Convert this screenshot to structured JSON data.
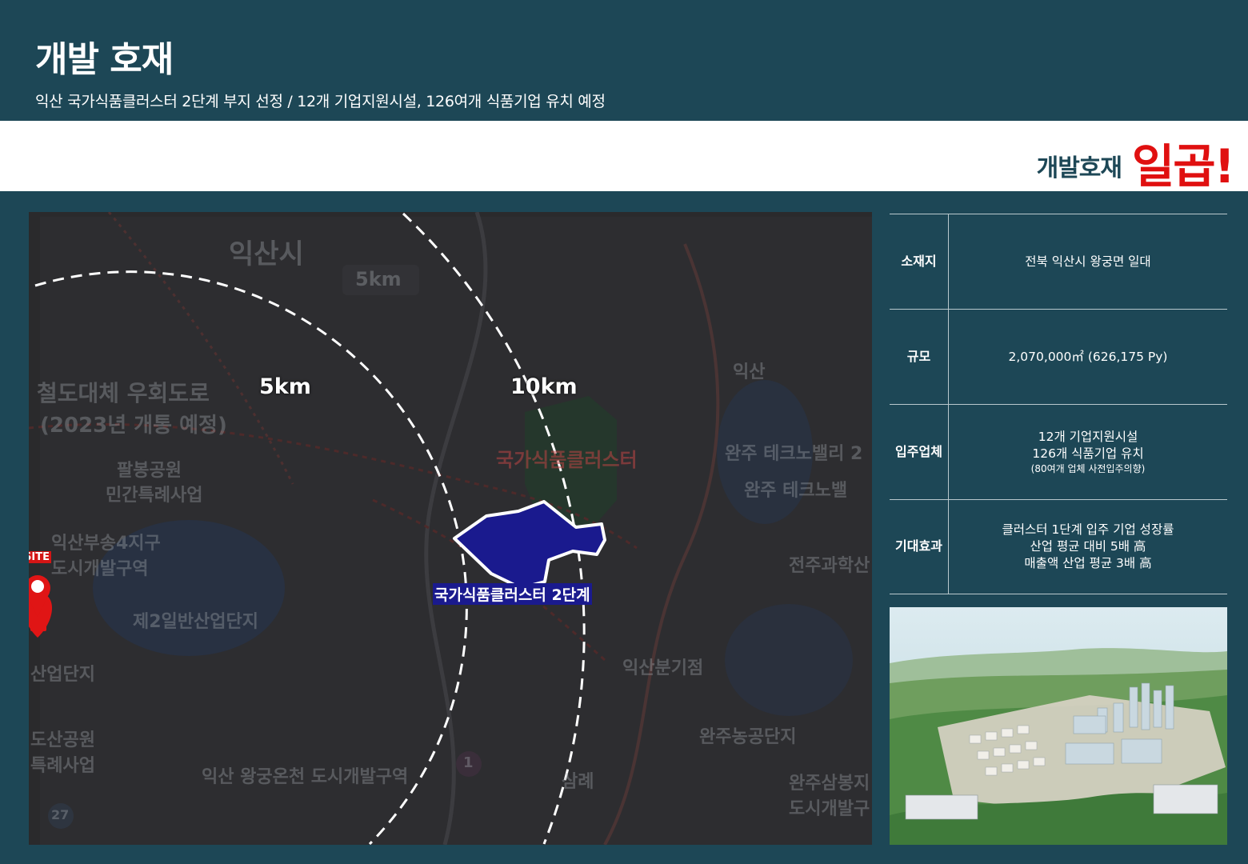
{
  "header": {
    "title": "개발 호재",
    "subtitle": "익산 국가식품클러스터 2단계 부지 선정 / 12개 기업지원시설, 126여개 식품기업 유치 예정"
  },
  "band": {
    "label": "개발호재",
    "emphasis": "일곱!"
  },
  "map": {
    "rings": [
      "5km",
      "10km"
    ],
    "cluster_label": "국가식품클러스터 2단계",
    "site_label": "SITE",
    "places": {
      "city": "익산시",
      "km_badge": "5km",
      "bypass_1": "철도대체 우회도로",
      "bypass_2": "(2023년 개통 예정)",
      "park_1": "팔봉공원",
      "park_2": "민간특례사업",
      "district_1": "익산부송4지구",
      "district_2": "도시개발구역",
      "industrial_2": "제2일반산업단지",
      "industrial_left": "산업단지",
      "park_left_1": "도산공원",
      "park_left_2": "특례사업",
      "wanggung": "익산 왕궁온천 도시개발구역",
      "iksan": "익산",
      "techno_1": "완주 테크노밸리 2",
      "techno_2": "완주 테크노밸",
      "jeonju_sci": "전주과학산",
      "branch": "익산분기점",
      "wanju_agri": "완주농공단지",
      "samnye": "삼례",
      "wanju_sambong_1": "완주삼봉지",
      "wanju_sambong_2": "도시개발구",
      "food_cluster": "국가식품클러스터",
      "road_num": "1",
      "road_num_2": "27"
    }
  },
  "info": [
    {
      "key": "소재지",
      "lines": [
        "전북 익산시 왕궁면 일대"
      ]
    },
    {
      "key": "규모",
      "lines": [
        "2,070,000㎡ (626,175 Py)"
      ]
    },
    {
      "key": "입주업체",
      "lines": [
        "12개 기업지원시설",
        "126개 식품기업 유치"
      ],
      "note": "(80여개 업체 사전입주의향)"
    },
    {
      "key": "기대효과",
      "lines": [
        "클러스터 1단계 입주 기업 성장률",
        "산업 평균 대비 5배 高",
        "매출액 산업 평균 3배 高"
      ]
    }
  ],
  "colors": {
    "background": "#1d4756",
    "accent_red": "#e01010",
    "cluster_fill": "#1a1a8e",
    "white": "#ffffff"
  }
}
